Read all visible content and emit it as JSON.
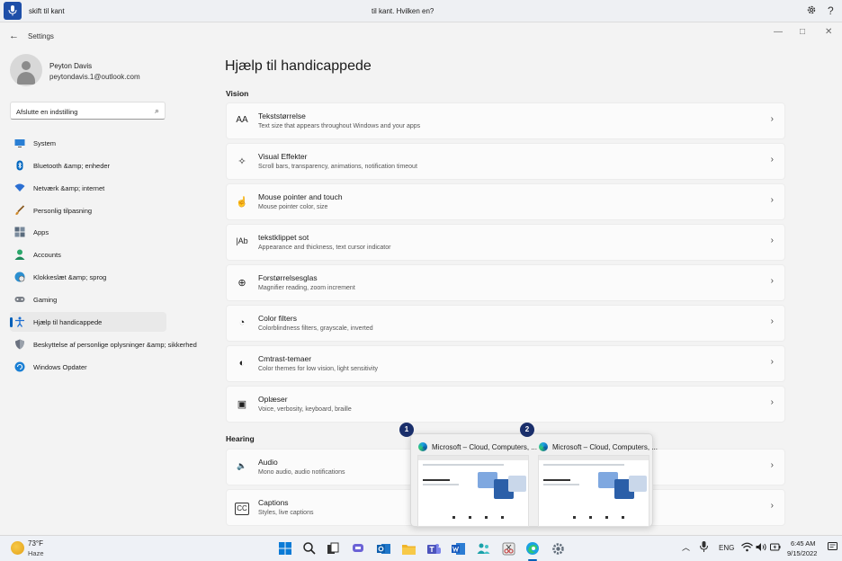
{
  "voice": {
    "left_text": "skift til kant",
    "center_text": "til kant. Hvilken en?",
    "settings_icon": "gear-icon",
    "help_label": "?"
  },
  "window": {
    "app_title": "Settings",
    "back_label": "←",
    "minimize_label": "—",
    "maximize_label": "□",
    "close_label": "✕"
  },
  "user": {
    "name": "Peyton Davis",
    "email": "peytondavis.1@outlook.com"
  },
  "search": {
    "value": "Afslutte en indstilling",
    "icon": "⌕"
  },
  "nav": [
    {
      "label": "System",
      "icon": "monitor-icon",
      "color": "#2a7fd4"
    },
    {
      "label": "Bluetooth &amp; enheder",
      "icon": "bluetooth-icon",
      "color": "#0067c0"
    },
    {
      "label": "Netværk &amp; internet",
      "icon": "wifi-icon",
      "color": "#2b6fd2"
    },
    {
      "label": "Personlig tilpasning",
      "icon": "brush-icon",
      "color": "#d08a2b"
    },
    {
      "label": "Apps",
      "icon": "apps-icon",
      "color": "#5a6b7d"
    },
    {
      "label": "Accounts",
      "icon": "person-icon",
      "color": "#2ca76b"
    },
    {
      "label": "Klokkeslæt &amp; sprog",
      "icon": "globe-clock-icon",
      "color": "#2b8fd0"
    },
    {
      "label": "Gaming",
      "icon": "gamepad-icon",
      "color": "#7a7f87"
    },
    {
      "label": "Hjælp til handicappede",
      "icon": "accessibility-icon",
      "color": "#1d6fd2"
    },
    {
      "label": "Beskyttelse af personlige oplysninger &amp; sikkerhed",
      "icon": "shield-icon",
      "color": "#6b7280"
    },
    {
      "label": "Windows Opdater",
      "icon": "update-icon",
      "color": "#1a7fd4"
    }
  ],
  "page": {
    "title": "Hjælp til handicappede",
    "section_vision": "Vision",
    "section_hearing": "Hearing"
  },
  "cards": [
    {
      "title": "Tekststørrelse",
      "subtitle": "Text size that appears throughout Windows and your apps",
      "icon": "AA"
    },
    {
      "title": "Visual Effekter",
      "subtitle": "Scroll bars, transparency, animations, notification timeout",
      "icon": "✧"
    },
    {
      "title": "Mouse pointer and touch",
      "subtitle": "Mouse pointer color, size",
      "icon": "☝"
    },
    {
      "title": "tekstklippet sot",
      "subtitle": "Appearance and thickness, text cursor indicator",
      "icon": "|Ab"
    },
    {
      "title": "Forstørrelsesglas",
      "subtitle": "Magnifier reading, zoom increment",
      "icon": "⊕"
    },
    {
      "title": "Color filters",
      "subtitle": "Colorblindness filters, grayscale, inverted",
      "icon": "◔"
    },
    {
      "title": "Cmtrast-temaer",
      "subtitle": "Color themes for low vision, light sensitivity",
      "icon": "◐"
    },
    {
      "title": "Oplæser",
      "subtitle": "Voice, verbosity, keyboard, braille",
      "icon": "▣"
    },
    {
      "title": "Audio",
      "subtitle": "Mono audio, audio notifications",
      "icon": "🔈"
    },
    {
      "title": "Captions",
      "subtitle": "Styles, live captions",
      "icon": "CC"
    }
  ],
  "chevron": "›",
  "thumbnails": [
    {
      "badge": "1",
      "title": "Microsoft – Cloud, Computers, ..."
    },
    {
      "badge": "2",
      "title": "Microsoft – Cloud, Computers, ..."
    }
  ],
  "taskbar": {
    "temp": "73°F",
    "condition": "Haze",
    "lang": "ENG",
    "time": "6:45 AM",
    "date": "9/15/2022",
    "caret": "︿"
  }
}
